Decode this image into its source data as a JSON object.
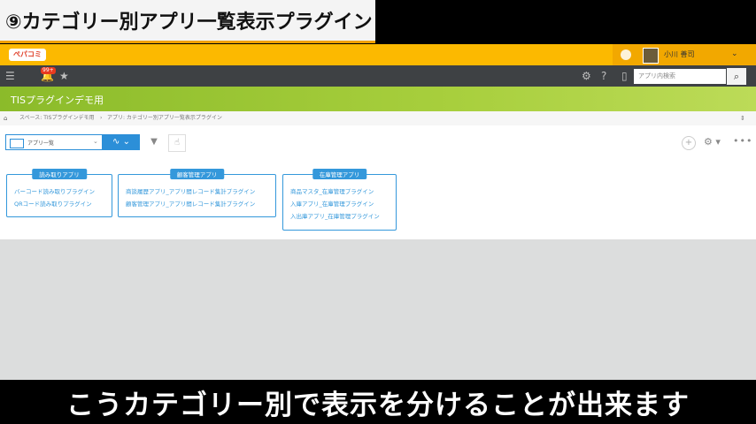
{
  "banner": {
    "title": "⑨カテゴリー別アプリ一覧表示プラグイン"
  },
  "app": {
    "logo_text": "ぺパコミ",
    "user_name": "小川 善司",
    "nav_badge": "99+",
    "search_placeholder": "アプリ内検索",
    "space_title": "TISプラグインデモ用",
    "breadcrumb": [
      "スペース: TISプラグインデモ用",
      "アプリ: カテゴリー別アプリ一覧表示プラグイン"
    ],
    "view_name": "アプリ一覧",
    "categories": [
      {
        "label": "読み取りアプリ",
        "items": [
          "バーコード読み取りプラグイン",
          "QRコード読み取りプラグイン"
        ]
      },
      {
        "label": "顧客管理アプリ",
        "items": [
          "商談履歴アプリ_アプリ間レコード集計プラグイン",
          "顧客管理アプリ_アプリ間レコード集計プラグイン"
        ]
      },
      {
        "label": "在庫管理アプリ",
        "items": [
          "商品マスタ_在庫管理プラグイン",
          "入庫アプリ_在庫管理プラグイン",
          "入出庫アプリ_在庫管理プラグイン"
        ]
      }
    ],
    "icons": {
      "menu": "menu-icon",
      "bell": "bell-icon",
      "star": "star-icon",
      "gear": "gear-icon",
      "help": "help-icon",
      "mobile": "mobile-icon",
      "search": "search-icon"
    }
  },
  "caption": {
    "text": "こうカテゴリー別で表示を分けることが出来ます"
  },
  "colors": {
    "topbar": "#fcb900",
    "navbar": "#3e4144",
    "header": "#a8cf3d",
    "accent": "#3498db"
  }
}
